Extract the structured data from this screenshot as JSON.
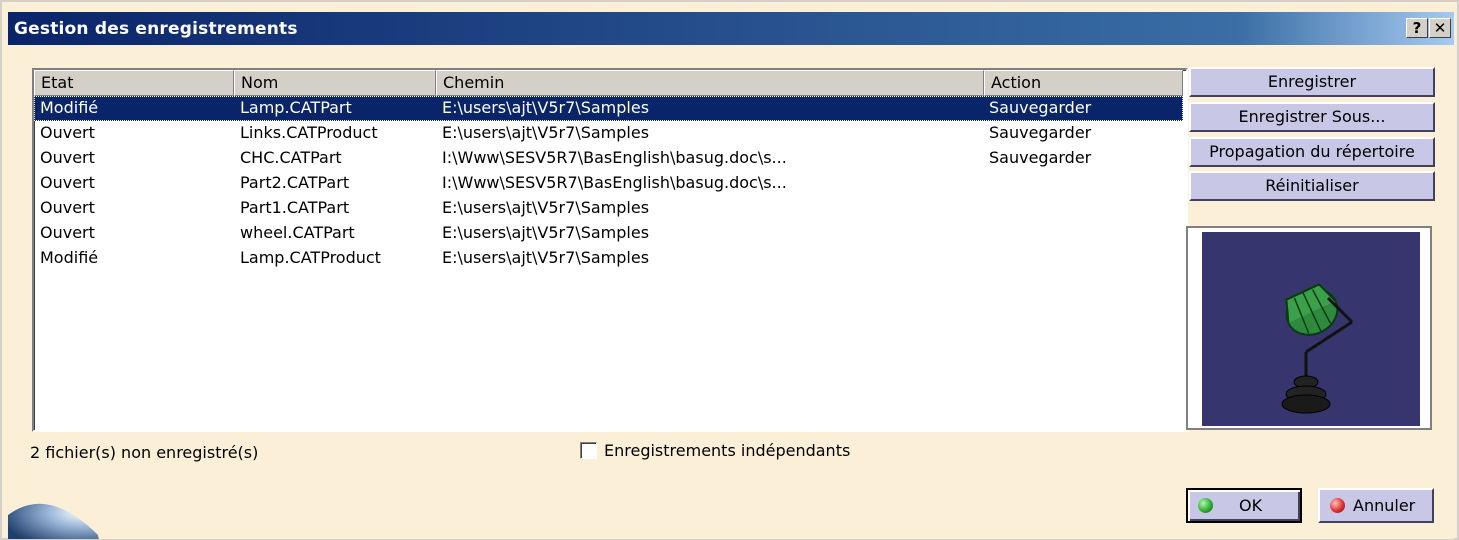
{
  "window": {
    "title": "Gestion des enregistrements",
    "help_label": "?",
    "close_label": "✕"
  },
  "table": {
    "columns": [
      "Etat",
      "Nom",
      "Chemin",
      "Action"
    ],
    "rows": [
      {
        "etat": "Modifié",
        "nom": "Lamp.CATPart",
        "chemin": "E:\\users\\ajt\\V5r7\\Samples",
        "action": "Sauvegarder",
        "selected": true
      },
      {
        "etat": "Ouvert",
        "nom": "Links.CATProduct",
        "chemin": "E:\\users\\ajt\\V5r7\\Samples",
        "action": "Sauvegarder"
      },
      {
        "etat": "Ouvert",
        "nom": "CHC.CATPart",
        "chemin": "I:\\Www\\SESV5R7\\BasEnglish\\basug.doc\\s...",
        "action": "Sauvegarder"
      },
      {
        "etat": "Ouvert",
        "nom": "Part2.CATPart",
        "chemin": "I:\\Www\\SESV5R7\\BasEnglish\\basug.doc\\s...",
        "action": ""
      },
      {
        "etat": "Ouvert",
        "nom": "Part1.CATPart",
        "chemin": "E:\\users\\ajt\\V5r7\\Samples",
        "action": ""
      },
      {
        "etat": "Ouvert",
        "nom": "wheel.CATPart",
        "chemin": "E:\\users\\ajt\\V5r7\\Samples",
        "action": ""
      },
      {
        "etat": "Modifié",
        "nom": "Lamp.CATProduct",
        "chemin": "E:\\users\\ajt\\V5r7\\Samples",
        "action": ""
      }
    ]
  },
  "side_buttons": {
    "save": "Enregistrer",
    "save_as": "Enregistrer Sous...",
    "propagate": "Propagation du répertoire",
    "reset": "Réinitialiser"
  },
  "status_text": "2 fichier(s) non enregistré(s)",
  "independent_checkbox": {
    "label": "Enregistrements indépendants",
    "checked": false
  },
  "footer": {
    "ok": "OK",
    "cancel": "Annuler"
  },
  "colors": {
    "title_bar": "#0a246a",
    "selection": "#0a246a",
    "button_face": "#c9c7e6",
    "preview_bg": "#36356e",
    "dialog_bg": "#fcefd8"
  }
}
